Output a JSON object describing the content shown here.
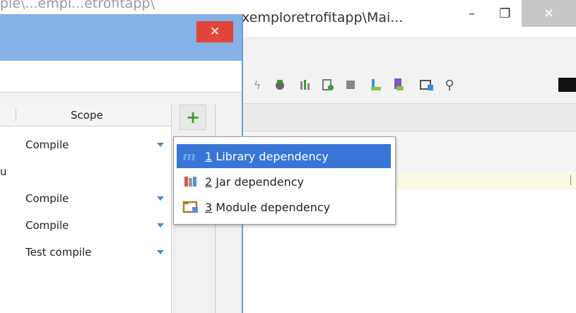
{
  "ide": {
    "title": "xemploretrofitapp\\Mai...",
    "title_left": "ple\\...empl...etrofitapp\\",
    "minimize_label": "–",
    "maximize_label": "❐",
    "close_label": "✕"
  },
  "dialog": {
    "close_label": "✕"
  },
  "dependencies": {
    "scope_header": "Scope",
    "add_label": "+",
    "rows": [
      {
        "left_text": "",
        "scope": "Compile",
        "has_dropdown": true
      },
      {
        "left_text": "u",
        "scope": "",
        "has_dropdown": false
      },
      {
        "left_text": "",
        "scope": "Compile",
        "has_dropdown": true
      },
      {
        "left_text": "",
        "scope": "Compile",
        "has_dropdown": true
      },
      {
        "left_text": "",
        "scope": "Test compile",
        "has_dropdown": true
      }
    ]
  },
  "popup_menu": {
    "items": [
      {
        "mnemonic": "1",
        "label": "Library dependency",
        "icon": "library-icon",
        "selected": true
      },
      {
        "mnemonic": "2",
        "label": "Jar dependency",
        "icon": "jar-icon",
        "selected": false
      },
      {
        "mnemonic": "3",
        "label": "Module dependency",
        "icon": "module-icon",
        "selected": false
      }
    ]
  },
  "colors": {
    "selection": "#3875d7",
    "dialog_titlebar": "#86b1e4",
    "close_red": "#e0453a",
    "add_green": "#3a9b3a",
    "dropdown_blue": "#3c8fd6"
  }
}
